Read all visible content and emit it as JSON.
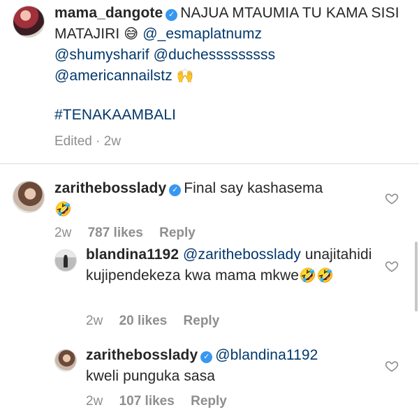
{
  "post": {
    "username": "mama_dangote",
    "caption_text": "NAJUA MTAUMIA TU KAMA SISI MATAJIRI",
    "caption_emoji": "😅",
    "mentions": [
      "@_esmaplatnumz",
      "@shumysharif",
      "@duchesssssssss",
      "@americannailstz"
    ],
    "mentions_emoji": "🙌",
    "hashtag": "#TENAKAAMBALI",
    "edited_label": "Edited",
    "time": "2w"
  },
  "comments": [
    {
      "username": "zarithebosslady",
      "text": "Final say kashasema",
      "emoji": "🤣",
      "time": "2w",
      "likes": "787 likes",
      "reply_label": "Reply"
    },
    {
      "username": "blandina1192",
      "mention": "@zarithebosslady",
      "text": "unajitahidi kujipendekeza kwa mama mkwe",
      "emoji": "🤣🤣",
      "time": "2w",
      "likes": "20 likes",
      "reply_label": "Reply"
    },
    {
      "username": "zarithebosslady",
      "mention": "@blandina1192",
      "text": "kweli punguka sasa",
      "time": "2w",
      "likes": "107 likes",
      "reply_label": "Reply"
    }
  ],
  "icons": {
    "verified": "verified-badge-icon",
    "like": "heart-outline-icon"
  },
  "colors": {
    "link": "#00376b",
    "verified": "#3897f0",
    "meta": "#8e8e8e"
  }
}
